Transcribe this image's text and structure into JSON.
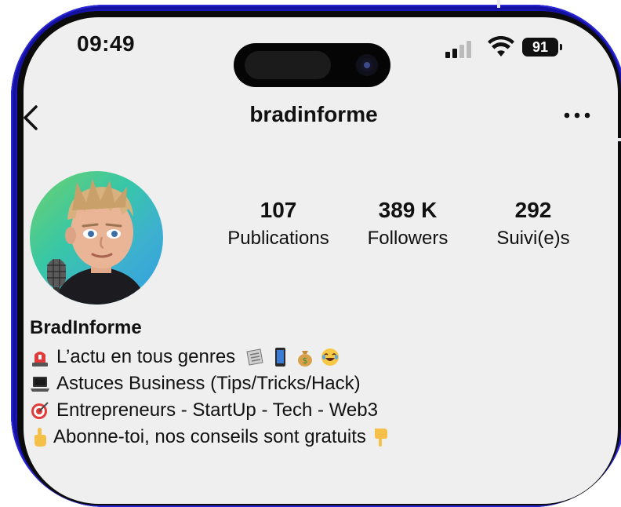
{
  "status_bar": {
    "time": "09:49",
    "battery": "91",
    "icons": [
      "signal-icon",
      "wifi-icon",
      "battery-icon"
    ]
  },
  "nav": {
    "username": "bradinforme",
    "back_icon": "chevron-left-icon",
    "more_icon": "more-horizontal-icon"
  },
  "profile": {
    "avatar": "avatar-cartoon-man-with-microphone",
    "stats": [
      {
        "value": "107",
        "label": "Publications"
      },
      {
        "value": "389 K",
        "label": "Followers"
      },
      {
        "value": "292",
        "label": "Suivi(e)s"
      }
    ],
    "display_name": "BradInforme",
    "bio": [
      {
        "icon": "siren-emoji",
        "text": "L’actu en tous genres",
        "trailing_icons": [
          "newspaper-emoji",
          "phone-emoji",
          "money-bag-emoji",
          "laughing-emoji"
        ]
      },
      {
        "icon": "laptop-emoji",
        "text": "Astuces Business (Tips/Tricks/Hack)"
      },
      {
        "icon": "target-emoji",
        "text": "Entrepreneurs - StartUp - Tech - Web3"
      },
      {
        "icon": "pointing-up-emoji",
        "text": "Abonne-toi, nos conseils sont gratuits",
        "trailing_icons": [
          "pointing-down-emoji"
        ]
      }
    ]
  },
  "colors": {
    "frame": "#1a17b8",
    "screen_bg": "#efefef",
    "text": "#111111"
  }
}
